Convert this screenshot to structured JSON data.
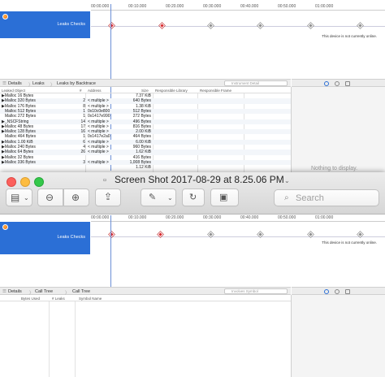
{
  "background_app": {
    "ruler_ticks": [
      "00:00.000",
      "00:10.000",
      "00:20.000",
      "00:30.000",
      "00:40.000",
      "00:50.000",
      "01:00.000"
    ],
    "track_label": "Leaks Checks",
    "device_notice": "This device is not currently online.",
    "detail_bar": {
      "details": "Details",
      "leaks": "Leaks",
      "leaks_by_backtrace": "Leaks by Backtrace",
      "filter_placeholder": "Instrument Detail"
    },
    "table": {
      "headers": [
        "Leaked Object",
        "#",
        "Address",
        "Size",
        "Responsible Library",
        "Responsible Frame"
      ],
      "rows": [
        [
          "▶Malloc 16 Bytes",
          "",
          "",
          "7.37 KiB"
        ],
        [
          "▶Malloc 320 Bytes",
          "2",
          "< multiple >",
          "640 Bytes"
        ],
        [
          "▶Malloc 176 Bytes",
          "8",
          "< multiple >",
          "1.38 KiB"
        ],
        [
          "Malloc 512 Bytes",
          "1",
          "0x10c0e800",
          "512 Bytes"
        ],
        [
          "Malloc 272 Bytes",
          "1",
          "0x1417e990",
          "272 Bytes"
        ],
        [
          "▶_NSCFString",
          "14",
          "< multiple >",
          "496 Bytes"
        ],
        [
          "▶Malloc 48 Bytes",
          "17",
          "< multiple >",
          "816 Bytes"
        ],
        [
          "▶Malloc 128 Bytes",
          "16",
          "< multiple >",
          "2.00 KiB"
        ],
        [
          "Malloc 464 Bytes",
          "1",
          "0x1417e2a0",
          "464 Bytes"
        ],
        [
          "▶Malloc 1.00 KiB",
          "6",
          "< multiple >",
          "6.00 KiB"
        ],
        [
          "▶Malloc 240 Bytes",
          "4",
          "< multiple >",
          "960 Bytes"
        ],
        [
          "▶Malloc 64 Bytes",
          "26",
          "< multiple >",
          "1.62 KiB"
        ],
        [
          "▶Malloc 32 Bytes",
          "",
          "",
          "416 Bytes"
        ],
        [
          "▶Malloc 336 Bytes",
          "3",
          "< multiple >",
          "1,008 Bytes"
        ],
        [
          "",
          "",
          "",
          "1.12 KiB"
        ]
      ]
    },
    "right_panel_text": "Nothing to display."
  },
  "preview_window": {
    "title": "Screen Shot 2017-08-29 at 8.25.06 PM",
    "search_placeholder": "Search",
    "inner": {
      "ruler_ticks": [
        "00:00.000",
        "00:10.000",
        "00:20.000",
        "00:30.000",
        "00:40.000",
        "00:50.000",
        "01:00.000"
      ],
      "track_label": "Leaks Checks",
      "device_notice": "This device is not currently online.",
      "detail_bar": {
        "details": "Details",
        "call_tree": "Call Tree",
        "call_tree_2": "Call Tree",
        "filter_placeholder": "Involves Symbol"
      },
      "table_headers": [
        "Bytes Used",
        "# Leaks",
        "Symbol Name"
      ]
    }
  },
  "colors": {
    "selection": "#2b6fd6",
    "leak_marker": "#d8262b",
    "ok_marker": "#8e8e8e"
  }
}
